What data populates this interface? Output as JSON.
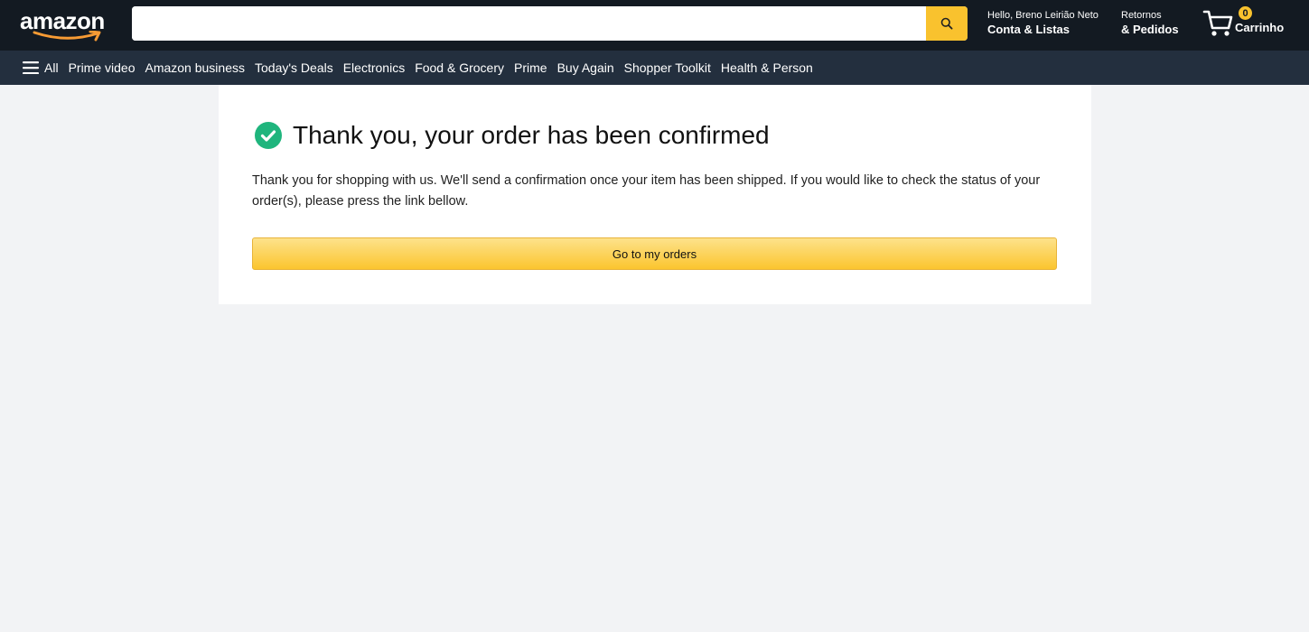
{
  "header": {
    "logo_text": "amazon",
    "search": {
      "value": "",
      "placeholder": ""
    },
    "account": {
      "greeting": "Hello, Breno Leirião Neto",
      "label": "Conta & Listas"
    },
    "orders": {
      "line1": "Retornos",
      "line2": "& Pedidos"
    },
    "cart": {
      "count": "0",
      "label": "Carrinho"
    },
    "colors": {
      "background": "#131a22",
      "accent": "#f9c22e"
    }
  },
  "nav": {
    "all_label": "All",
    "items": [
      "Prime video",
      "Amazon business",
      "Today's Deals",
      "Electronics",
      "Food & Grocery",
      "Prime",
      "Buy Again",
      "Shopper Toolkit",
      "Health & Person"
    ]
  },
  "confirmation": {
    "icon": "check-circle-icon",
    "icon_color": "#1fb57d",
    "title": "Thank you, your order has been confirmed",
    "message": "Thank you for shopping with us. We'll send a confirmation once your item has been shipped. If you would like to check the status of your order(s), please press the link bellow.",
    "button_label": "Go to my orders"
  }
}
